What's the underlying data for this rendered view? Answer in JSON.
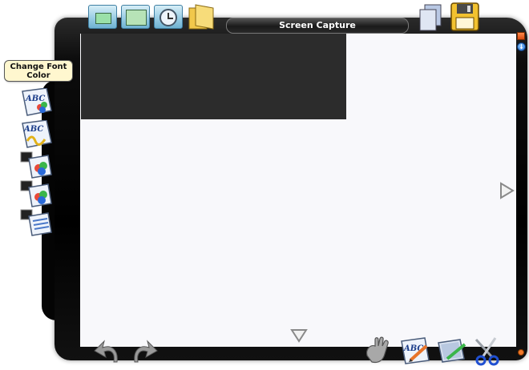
{
  "window": {
    "title": "Screen Capture"
  },
  "tooltip": {
    "text": "Change Font Color"
  },
  "top_toolbar": {
    "buttons": [
      {
        "icon": "window-icon"
      },
      {
        "icon": "fullscreen-icon"
      },
      {
        "icon": "clock-icon"
      },
      {
        "icon": "folder-icon"
      }
    ],
    "right_buttons": [
      {
        "icon": "pages-icon"
      },
      {
        "icon": "floppy-disk-icon"
      }
    ]
  },
  "side_toolbar": {
    "buttons": [
      {
        "icon": "abc-paint-icon"
      },
      {
        "icon": "abc-wave-icon"
      },
      {
        "icon": "layers-color-icon"
      },
      {
        "icon": "layers-color-icon-2"
      },
      {
        "icon": "layers-lines-icon"
      }
    ]
  },
  "bottom_toolbar": {
    "buttons": [
      {
        "icon": "undo-icon"
      },
      {
        "icon": "redo-icon"
      },
      {
        "icon": "grab-hand-icon"
      },
      {
        "icon": "abc-pen-icon"
      },
      {
        "icon": "screen-pen-icon"
      },
      {
        "icon": "scissors-icon"
      }
    ]
  },
  "colors": {
    "canvas": "#f8f8fb",
    "frame": "#000000",
    "dark_region": "#2c2c2c",
    "tooltip_bg": "#fff7cf",
    "accent_orange": "#f27a2a",
    "accent_blue": "#1f6fd1"
  }
}
